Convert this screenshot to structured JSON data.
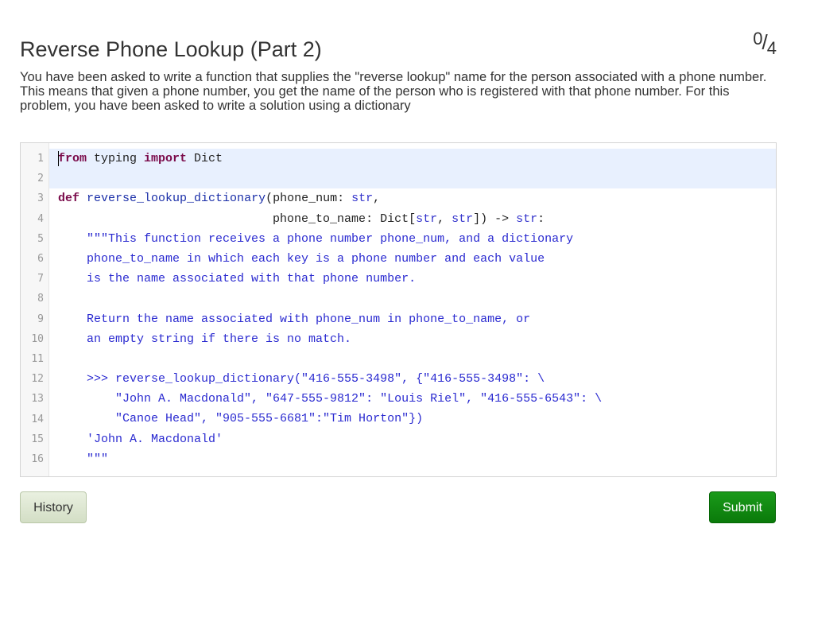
{
  "header": {
    "title": "Reverse Phone Lookup (Part 2)",
    "score_earned": "0",
    "score_separator": "/",
    "score_total": "4"
  },
  "description": "You have been asked to write a function that supplies the \"reverse lookup\" name for the person associated with a phone number. This means that given a phone number, you get the name of the person who is registered with that phone number. For this problem, you have been asked to write a solution using a dictionary",
  "editor": {
    "line_numbers": [
      "1",
      "2",
      "3",
      "4",
      "5",
      "6",
      "7",
      "8",
      "9",
      "10",
      "11",
      "12",
      "13",
      "14",
      "15",
      "16"
    ],
    "lines": [
      [
        {
          "t": "from",
          "c": "kw"
        },
        {
          "t": " typing ",
          "c": ""
        },
        {
          "t": "import",
          "c": "kw"
        },
        {
          "t": " Dict",
          "c": ""
        }
      ],
      [],
      [
        {
          "t": "def",
          "c": "kw"
        },
        {
          "t": " ",
          "c": ""
        },
        {
          "t": "reverse_lookup_dictionary",
          "c": "fn"
        },
        {
          "t": "(phone_num: ",
          "c": ""
        },
        {
          "t": "str",
          "c": "bi"
        },
        {
          "t": ",",
          "c": ""
        }
      ],
      [
        {
          "t": "                              phone_to_name: Dict[",
          "c": ""
        },
        {
          "t": "str",
          "c": "bi"
        },
        {
          "t": ", ",
          "c": ""
        },
        {
          "t": "str",
          "c": "bi"
        },
        {
          "t": "]) -> ",
          "c": ""
        },
        {
          "t": "str",
          "c": "bi"
        },
        {
          "t": ":",
          "c": ""
        }
      ],
      [
        {
          "t": "    \"\"\"This function receives a phone number phone_num, and a dictionary",
          "c": "st"
        }
      ],
      [
        {
          "t": "    phone_to_name in which each key is a phone number and each value",
          "c": "st"
        }
      ],
      [
        {
          "t": "    is the name associated with that phone number.",
          "c": "st"
        }
      ],
      [],
      [
        {
          "t": "    Return the name associated with phone_num in phone_to_name, or",
          "c": "st"
        }
      ],
      [
        {
          "t": "    an empty string if there is no match.",
          "c": "st"
        }
      ],
      [],
      [
        {
          "t": "    >>> reverse_lookup_dictionary(\"416-555-3498\", {\"416-555-3498\": \\",
          "c": "st"
        }
      ],
      [
        {
          "t": "        \"John A. Macdonald\", \"647-555-9812\": \"Louis Riel\", \"416-555-6543\": \\",
          "c": "st"
        }
      ],
      [
        {
          "t": "        \"Canoe Head\", \"905-555-6681\":\"Tim Horton\"})",
          "c": "st"
        }
      ],
      [
        {
          "t": "    'John A. Macdonald'",
          "c": "st"
        }
      ],
      [
        {
          "t": "    \"\"\"",
          "c": "st"
        }
      ]
    ]
  },
  "buttons": {
    "history_label": "History",
    "submit_label": "Submit"
  },
  "colors": {
    "submit_bg": "#0a7a0a",
    "history_bg": "#dfe8d3",
    "keyword": "#7a0a4a",
    "string": "#2a2ad0",
    "active_line": "#e8f0fe"
  }
}
